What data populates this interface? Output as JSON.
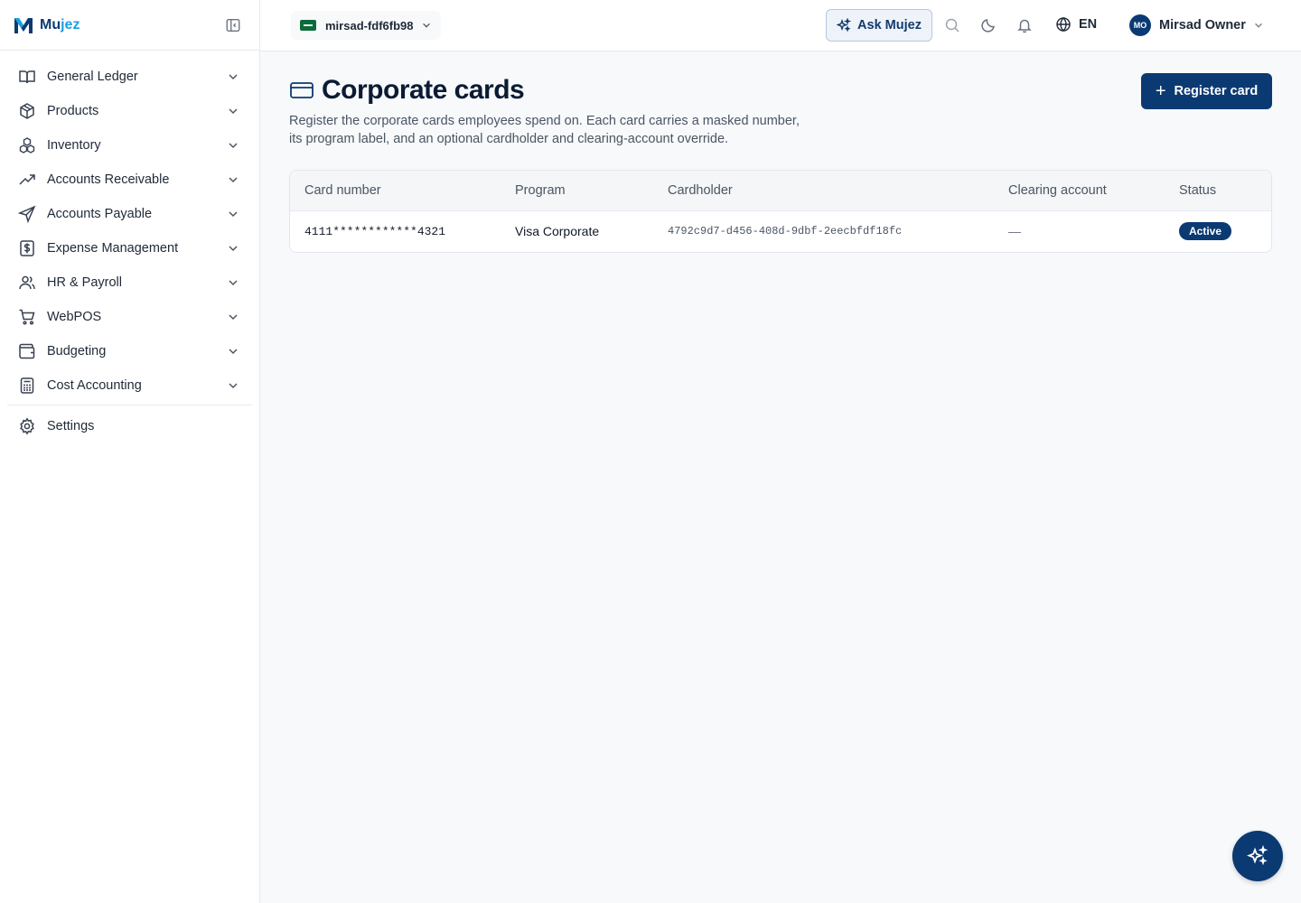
{
  "brand": {
    "name_main": "Mu",
    "name_accent": "jez"
  },
  "sidebar": {
    "items": [
      {
        "label": "General Ledger",
        "icon": "book-open-icon"
      },
      {
        "label": "Products",
        "icon": "box-icon"
      },
      {
        "label": "Inventory",
        "icon": "boxes-icon"
      },
      {
        "label": "Accounts Receivable",
        "icon": "trending-up-icon"
      },
      {
        "label": "Accounts Payable",
        "icon": "send-icon"
      },
      {
        "label": "Expense Management",
        "icon": "receipt-dollar-icon"
      },
      {
        "label": "HR & Payroll",
        "icon": "users-icon"
      },
      {
        "label": "WebPOS",
        "icon": "cart-icon"
      },
      {
        "label": "Budgeting",
        "icon": "wallet-icon"
      },
      {
        "label": "Cost Accounting",
        "icon": "calculator-icon"
      }
    ],
    "settings_label": "Settings"
  },
  "topbar": {
    "tenant": "mirsad-fdf6fb98",
    "ask_label": "Ask Mujez",
    "language": "EN",
    "user_initials": "MO",
    "user_name": "Mirsad Owner"
  },
  "page": {
    "title": "Corporate cards",
    "description": "Register the corporate cards employees spend on. Each card carries a masked number, its program label, and an optional cardholder and clearing-account override.",
    "register_label": "Register card",
    "register_plus": "+"
  },
  "table": {
    "headers": [
      "Card number",
      "Program",
      "Cardholder",
      "Clearing account",
      "Status"
    ],
    "rows": [
      {
        "card_number": "4111************4321",
        "program": "Visa Corporate",
        "cardholder": "4792c9d7-d456-408d-9dbf-2eecbfdf18fc",
        "clearing_account": "—",
        "status": "Active"
      }
    ]
  },
  "colors": {
    "primary": "#0b3a73",
    "accent": "#1aa0e3",
    "background": "#f7f9fb"
  }
}
